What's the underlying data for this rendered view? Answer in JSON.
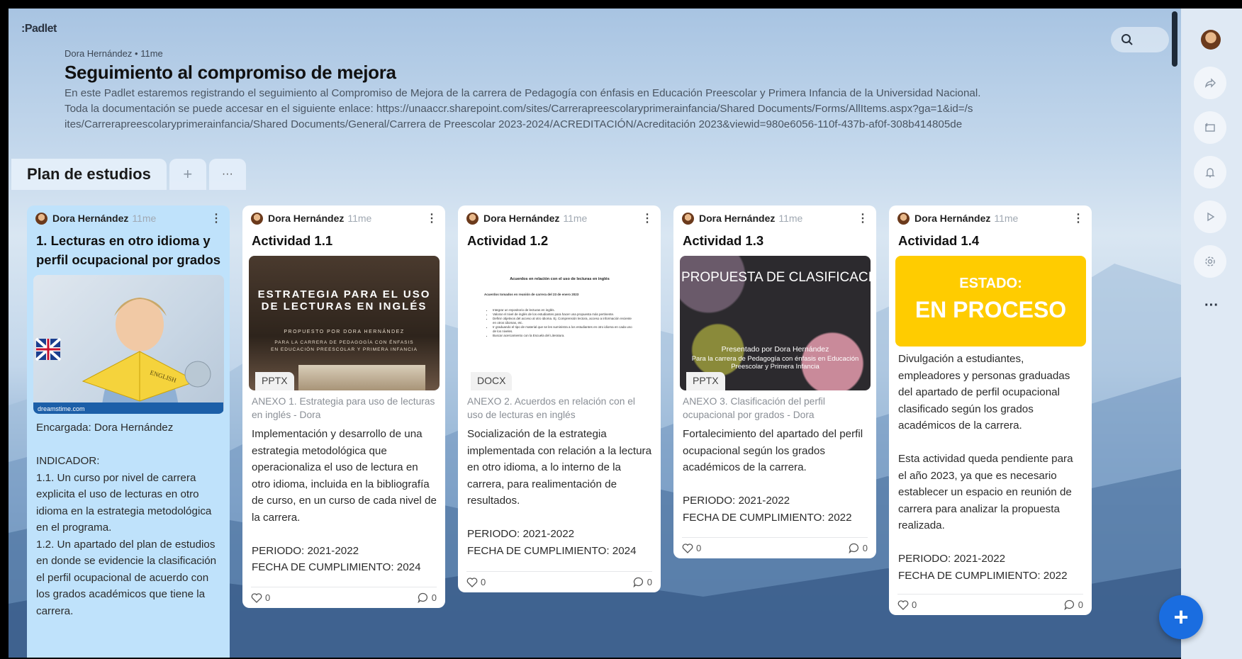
{
  "app": {
    "logo": ":Padlet"
  },
  "header": {
    "author": "Dora Hernández",
    "separator": "•",
    "time": "11me",
    "title": "Seguimiento al compromiso de mejora",
    "description": "En este Padlet estaremos registrando el seguimiento al Compromiso de Mejora de la carrera de Pedagogía con énfasis en Educación Preescolar y Primera Infancia de la Universidad Nacional.\nToda la documentación se puede accesar en el siguiente enlace: https://unaaccr.sharepoint.com/sites/Carrerapreescolaryprimerainfancia/Shared Documents/Forms/AllItems.aspx?ga=1&id=/s\nites/Carrerapreescolaryprimerainfancia/Shared Documents/General/Carrera de Preescolar 2023-2024/ACREDITACIÓN/Acreditación 2023&viewid=980e6056-110f-437b-af0f-308b414805de"
  },
  "section": {
    "title": "Plan de estudios",
    "add_label": "+",
    "more_label": "···"
  },
  "cards": [
    {
      "author": "Dora Hernández",
      "time": "11me",
      "title": "1. Lecturas en otro idioma y perfil ocupacional por grados",
      "image_watermark": "dreamstime.com",
      "image_book_text": "ENGLISH",
      "body": "Encargada: Dora Hernández\n\nINDICADOR:\n1.1. Un curso por nivel de carrera explicita el uso de lecturas en otro idioma en la estrategia metodológica en el programa.\n1.2. Un apartado del plan de estudios en donde se evidencie la clasificación el perfil ocupacional de acuerdo con los grados académicos que tiene la carrera.",
      "likes": "0",
      "comments": "0"
    },
    {
      "author": "Dora Hernández",
      "time": "11me",
      "title": "Actividad 1.1",
      "slide_title": "ESTRATEGIA PARA EL USO DE LECTURAS EN INGLÉS",
      "slide_sub": "PROPUESTO POR DORA HERNÁNDEZ",
      "slide_sub2": "PARA LA CARRERA DE PEDAGOGÍA CON ÉNFASIS EN EDUCACIÓN PREESCOLAR Y PRIMERA INFANCIA",
      "file_type": "PPTX",
      "attachment": "ANEXO 1. Estrategia para uso de lecturas en inglés - Dora",
      "body": "Implementación y desarrollo de una estrategia metodológica que operacionaliza el uso de lectura en otro idioma, incluida en la bibliografía de curso, en un curso de cada nivel de la carrera.\n\nPERIODO: 2021-2022\nFECHA DE CUMPLIMIENTO: 2024",
      "likes": "0",
      "comments": "0"
    },
    {
      "author": "Dora Hernández",
      "time": "11me",
      "title": "Actividad 1.2",
      "doc_title": "Acuerdos en relación con el uso de lecturas en inglés",
      "doc_sub": "Acuerdos tomados en reunión de carrera del 23 de enero 2023",
      "doc_items": [
        "Integrar un repositorio de lecturas en inglés.",
        "Valorar el nivel de inglés de los estudiantes para hacer una propuesta más pertinente.",
        "Definir objetivos del acceso al otro idioma. Ej. Comprensión lectora, acceso a información reciente en otros idiomas, etc.",
        "Ir graduando el tipo de material que se les suministra a los estudiantes en otro idioma en cada uno de los niveles.",
        "Buscar acercamiento con la Escuela del Literatura."
      ],
      "file_type": "DOCX",
      "attachment": "ANEXO 2. Acuerdos en relación con el uso de lecturas en inglés",
      "body": "Socialización de la estrategia implementada con relación a la lectura en otro idioma, a lo interno de la carrera, para realimentación de resultados.\n\nPERIODO: 2021-2022\nFECHA DE CUMPLIMIENTO: 2024",
      "likes": "0",
      "comments": "0"
    },
    {
      "author": "Dora Hernández",
      "time": "11me",
      "title": "Actividad 1.3",
      "slide_title": "PROPUESTA DE CLASIFICACIÓN DEL PERFIL OCUPACIONAL POR GRADOS",
      "slide_sub": "Presentado por Dora Hernández",
      "slide_sub2": "Para la carrera de Pedagogía con énfasis en Educación Preescolar y Primera Infancia",
      "file_type": "PPTX",
      "attachment": "ANEXO 3. Clasificación del perfil ocupacional por grados - Dora",
      "body": "Fortalecimiento del apartado del perfil ocupacional según los grados académicos de la carrera.\n\nPERIODO: 2021-2022\nFECHA DE CUMPLIMIENTO: 2022",
      "likes": "0",
      "comments": "0"
    },
    {
      "author": "Dora Hernández",
      "time": "11me",
      "title": "Actividad 1.4",
      "status_label": "ESTADO:",
      "status_value": "EN PROCESO",
      "body": "Divulgación a estudiantes, empleadores y personas graduadas del apartado de perfil ocupacional clasificado según los grados académicos de la carrera.\n\nEsta actividad queda pendiente para el año 2023, ya que es necesario establecer un espacio en reunión de carrera para analizar la propuesta realizada.\n\nPERIODO: 2021-2022\nFECHA DE CUMPLIMIENTO: 2022",
      "likes": "0",
      "comments": "0"
    }
  ],
  "sidebar": {
    "more_label": "···"
  },
  "fab": {
    "label": "+"
  },
  "colors": {
    "accent": "#1a6de0",
    "status_yellow": "#ffcc00",
    "card_blue": "#bfe2fb"
  }
}
